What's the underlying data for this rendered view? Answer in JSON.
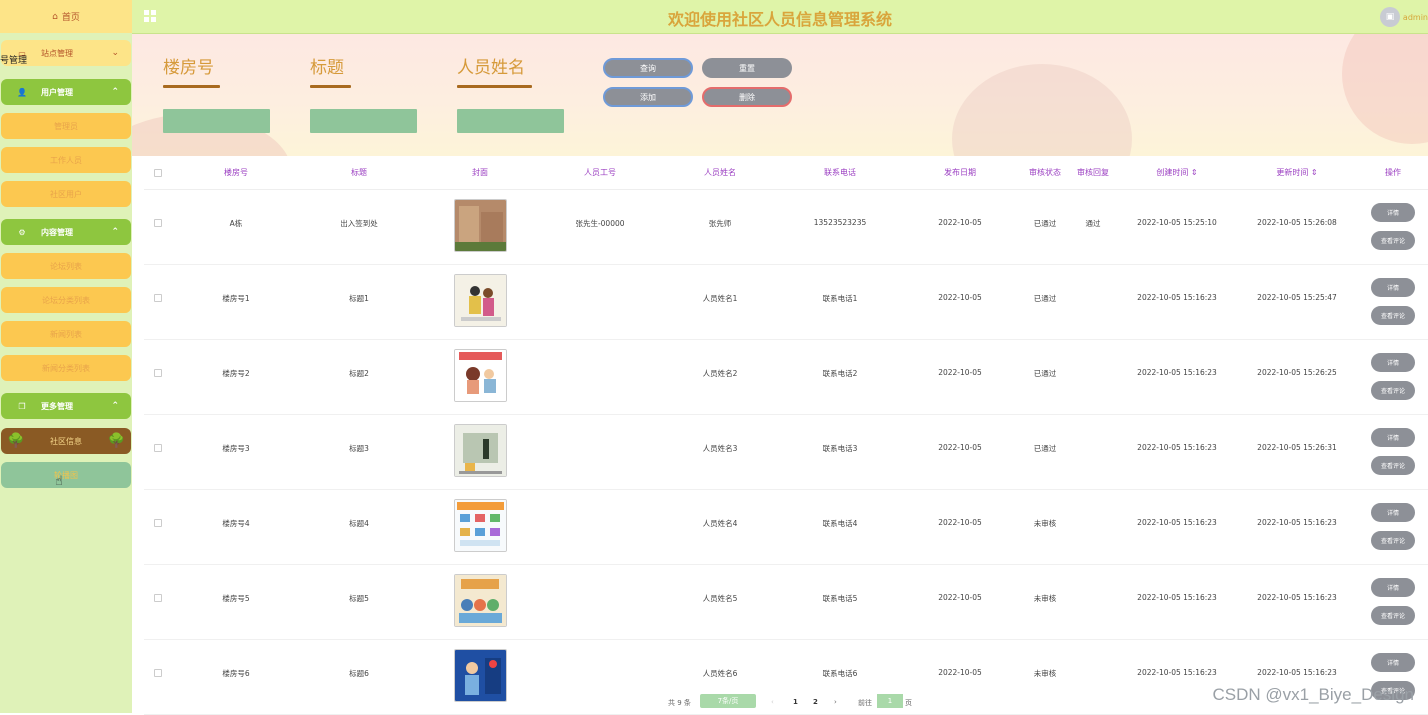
{
  "sidebar": {
    "home": "首页",
    "menus": [
      {
        "label": "站点管理",
        "kind": "parent-yellow",
        "icon": "monitor-icon",
        "chev": "⌄"
      },
      {
        "label": "用户管理",
        "kind": "parent-green",
        "icon": "user-icon",
        "chev": "⌃"
      },
      {
        "label": "管理员",
        "kind": "child"
      },
      {
        "label": "工作人员",
        "kind": "child"
      },
      {
        "label": "社区用户",
        "kind": "child"
      },
      {
        "label": "内容管理",
        "kind": "parent-green",
        "icon": "settings-icon",
        "chev": "⌃"
      },
      {
        "label": "论坛列表",
        "kind": "child"
      },
      {
        "label": "论坛分类列表",
        "kind": "child"
      },
      {
        "label": "新闻列表",
        "kind": "child"
      },
      {
        "label": "新闻分类列表",
        "kind": "child"
      },
      {
        "label": "更多管理",
        "kind": "parent-green",
        "icon": "copy-icon",
        "chev": "⌃"
      },
      {
        "label": "社区信息",
        "kind": "active"
      },
      {
        "label": "轮播图",
        "kind": "hover"
      }
    ],
    "overflow_text": "号管理"
  },
  "header": {
    "title": "欢迎使用社区人员信息管理系统",
    "user": "admin"
  },
  "search": {
    "fields": [
      {
        "label": "楼房号"
      },
      {
        "label": "标题"
      },
      {
        "label": "人员姓名"
      }
    ],
    "buttons": {
      "query": "查询",
      "reset": "重置",
      "add": "添加",
      "delete": "删除"
    }
  },
  "table": {
    "headers": [
      "楼房号",
      "标题",
      "封面",
      "人员工号",
      "人员姓名",
      "联系电话",
      "发布日期",
      "审核状态",
      "审核回复",
      "创建时间 ⇕",
      "更新时间 ⇕",
      "操作"
    ],
    "rows": [
      {
        "building": "A栋",
        "title": "出入签到处",
        "emp_no": "张先生-00000",
        "name": "张先师",
        "phone": "13523523235",
        "date": "2022-10-05",
        "status": "已通过",
        "reply": "通过",
        "created": "2022-10-05 15:25:10",
        "updated": "2022-10-05 15:26:08",
        "cover": "building"
      },
      {
        "building": "楼房号1",
        "title": "标题1",
        "emp_no": "",
        "name": "人员姓名1",
        "phone": "联系电话1",
        "date": "2022-10-05",
        "status": "已通过",
        "reply": "",
        "created": "2022-10-05 15:16:23",
        "updated": "2022-10-05 15:25:47",
        "cover": "people"
      },
      {
        "building": "楼房号2",
        "title": "标题2",
        "emp_no": "",
        "name": "人员姓名2",
        "phone": "联系电话2",
        "date": "2022-10-05",
        "status": "已通过",
        "reply": "",
        "created": "2022-10-05 15:16:23",
        "updated": "2022-10-05 15:26:25",
        "cover": "check"
      },
      {
        "building": "楼房号3",
        "title": "标题3",
        "emp_no": "",
        "name": "人员姓名3",
        "phone": "联系电话3",
        "date": "2022-10-05",
        "status": "已通过",
        "reply": "",
        "created": "2022-10-05 15:16:23",
        "updated": "2022-10-05 15:26:31",
        "cover": "door"
      },
      {
        "building": "楼房号4",
        "title": "标题4",
        "emp_no": "",
        "name": "人员姓名4",
        "phone": "联系电话4",
        "date": "2022-10-05",
        "status": "未审核",
        "reply": "",
        "created": "2022-10-05 15:16:23",
        "updated": "2022-10-05 15:16:23",
        "cover": "poster"
      },
      {
        "building": "楼房号5",
        "title": "标题5",
        "emp_no": "",
        "name": "人员姓名5",
        "phone": "联系电话5",
        "date": "2022-10-05",
        "status": "未审核",
        "reply": "",
        "created": "2022-10-05 15:16:23",
        "updated": "2022-10-05 15:16:23",
        "cover": "crowd"
      },
      {
        "building": "楼房号6",
        "title": "标题6",
        "emp_no": "",
        "name": "人员姓名6",
        "phone": "联系电话6",
        "date": "2022-10-05",
        "status": "未审核",
        "reply": "",
        "created": "2022-10-05 15:16:23",
        "updated": "2022-10-05 15:16:23",
        "cover": "blue"
      }
    ],
    "op_labels": {
      "detail": "详情",
      "comment": "查看评论"
    }
  },
  "pager": {
    "total": "共 9 条",
    "size": "7条/页",
    "prev": "‹",
    "pages": [
      "1",
      "2"
    ],
    "next": "›",
    "goto_prefix": "前往",
    "goto_value": "1",
    "goto_suffix": "页"
  },
  "watermark": "CSDN @vx1_Biye_Design"
}
